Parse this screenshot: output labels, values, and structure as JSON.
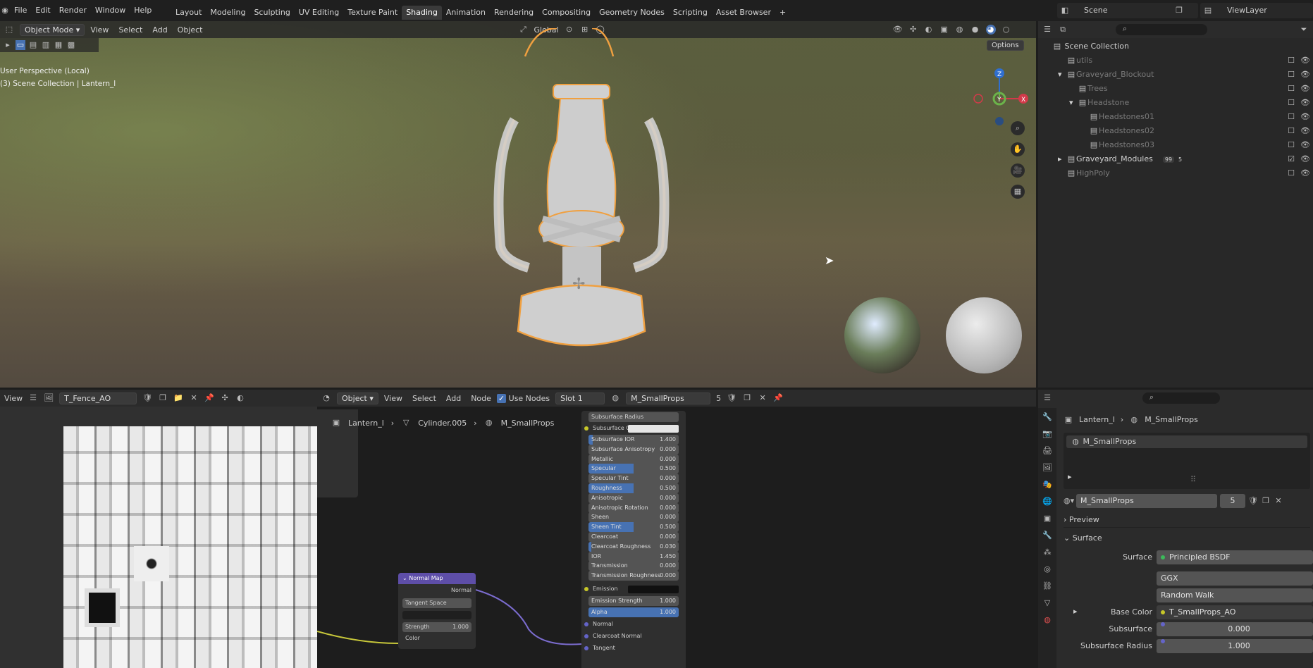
{
  "topbar": {
    "menus": [
      "File",
      "Edit",
      "Render",
      "Window",
      "Help"
    ],
    "workspaces": [
      "Layout",
      "Modeling",
      "Sculpting",
      "UV Editing",
      "Texture Paint",
      "Shading",
      "Animation",
      "Rendering",
      "Compositing",
      "Geometry Nodes",
      "Scripting",
      "Asset Browser"
    ],
    "active_workspace": "Shading",
    "add_tab": "+",
    "scene": "Scene",
    "view_layer": "ViewLayer"
  },
  "viewport": {
    "mode": "Object Mode",
    "menus": [
      "View",
      "Select",
      "Add",
      "Object"
    ],
    "orientation": "Global",
    "options": "Options",
    "overlay_line1": "User Perspective (Local)",
    "overlay_line2": "(3) Scene Collection | Lantern_l",
    "gizmo": {
      "x": "X",
      "y": "Y",
      "z": "Z"
    }
  },
  "outliner": {
    "root": "Scene Collection",
    "items": [
      {
        "label": "utils",
        "level": 1,
        "dim": true,
        "toggle": ""
      },
      {
        "label": "Graveyard_Blockout",
        "level": 1,
        "dim": true,
        "toggle": "▾"
      },
      {
        "label": "Trees",
        "level": 2,
        "dim": true,
        "toggle": ""
      },
      {
        "label": "Headstone",
        "level": 2,
        "dim": true,
        "toggle": "▾"
      },
      {
        "label": "Headstones01",
        "level": 3,
        "dim": true,
        "toggle": ""
      },
      {
        "label": "Headstones02",
        "level": 3,
        "dim": true,
        "toggle": ""
      },
      {
        "label": "Headstones03",
        "level": 3,
        "dim": true,
        "toggle": ""
      },
      {
        "label": "Graveyard_Modules",
        "level": 1,
        "dim": false,
        "toggle": "▸"
      },
      {
        "label": "HighPoly",
        "level": 1,
        "dim": true,
        "toggle": ""
      }
    ],
    "modules_badge": "99",
    "modules_badge2": "5"
  },
  "image_editor": {
    "view": "View",
    "image_name": "T_Fence_AO"
  },
  "node_editor": {
    "object": "Object",
    "menus": [
      "View",
      "Select",
      "Add",
      "Node"
    ],
    "use_nodes": "Use Nodes",
    "slot": "Slot 1",
    "material": "M_SmallProps",
    "users": "5",
    "breadcrumb": [
      "Lantern_l",
      "Cylinder.005",
      "M_SmallProps"
    ],
    "normal_map": {
      "title": "Normal Map",
      "output": "Normal",
      "space": "Tangent Space",
      "strength_label": "Strength",
      "strength": "1.000",
      "color": "Color"
    },
    "bsdf": {
      "dropdown": "Subsurface Radius",
      "subsurface_color": "Subsurface Color",
      "sliders": [
        {
          "label": "Subsurface IOR",
          "value": "1.400",
          "fill": 0.05
        },
        {
          "label": "Subsurface Anisotropy",
          "value": "0.000",
          "fill": 0
        },
        {
          "label": "Metallic",
          "value": "0.000",
          "fill": 0
        },
        {
          "label": "Specular",
          "value": "0.500",
          "fill": 0.5
        },
        {
          "label": "Specular Tint",
          "value": "0.000",
          "fill": 0
        },
        {
          "label": "Roughness",
          "value": "0.500",
          "fill": 0.5
        },
        {
          "label": "Anisotropic",
          "value": "0.000",
          "fill": 0
        },
        {
          "label": "Anisotropic Rotation",
          "value": "0.000",
          "fill": 0
        },
        {
          "label": "Sheen",
          "value": "0.000",
          "fill": 0
        },
        {
          "label": "Sheen Tint",
          "value": "0.500",
          "fill": 0.5
        },
        {
          "label": "Clearcoat",
          "value": "0.000",
          "fill": 0
        },
        {
          "label": "Clearcoat Roughness",
          "value": "0.030",
          "fill": 0.03
        },
        {
          "label": "IOR",
          "value": "1.450",
          "fill": 0
        },
        {
          "label": "Transmission",
          "value": "0.000",
          "fill": 0
        },
        {
          "label": "Transmission Roughness",
          "value": "0.000",
          "fill": 0
        }
      ],
      "emission": "Emission",
      "emission_strength": {
        "label": "Emission Strength",
        "value": "1.000"
      },
      "alpha": {
        "label": "Alpha",
        "value": "1.000",
        "fill": 1
      },
      "inputs": [
        "Normal",
        "Clearcoat Normal",
        "Tangent"
      ]
    }
  },
  "properties": {
    "breadcrumb": [
      "Lantern_l",
      "M_SmallProps"
    ],
    "material_slot": "M_SmallProps",
    "material": "M_SmallProps",
    "users": "5",
    "preview": "Preview",
    "surface_panel": "Surface",
    "surface_label": "Surface",
    "surface_value": "Principled BSDF",
    "distribution": "GGX",
    "subsurface_method": "Random Walk",
    "base_color_label": "Base Color",
    "base_color_value": "T_SmallProps_AO",
    "subsurface_label": "Subsurface",
    "subsurface_value": "0.000",
    "subsurface_radius_label": "Subsurface Radius",
    "subsurface_radius_value": "1.000"
  }
}
